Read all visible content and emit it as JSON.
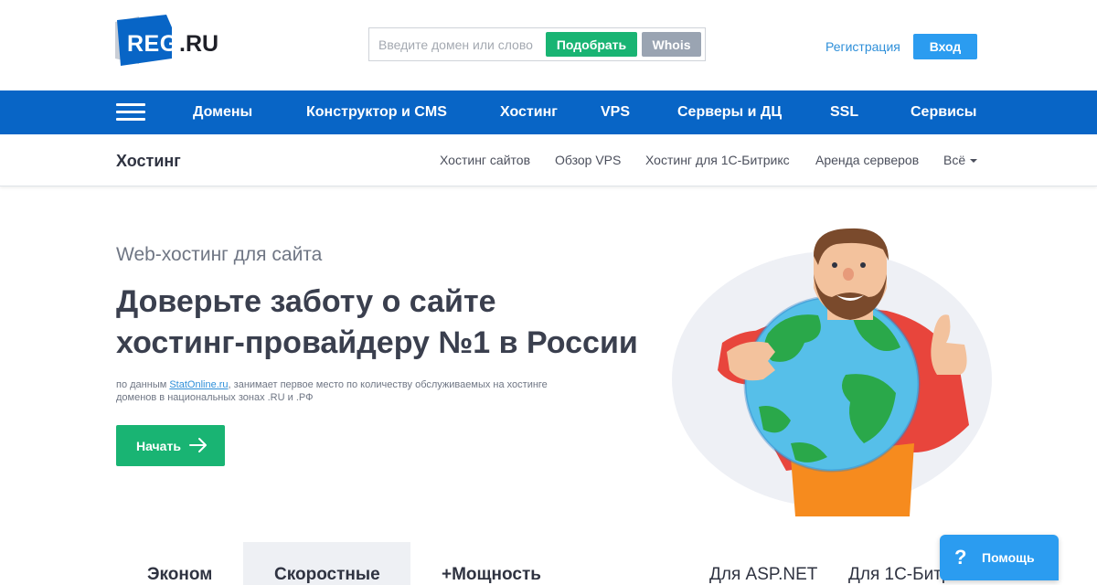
{
  "header": {
    "logo": {
      "brand": "REG",
      "suffix": ".RU"
    },
    "search": {
      "placeholder": "Введите домен или слово",
      "pick_label": "Подобрать",
      "whois_label": "Whois"
    },
    "register_label": "Регистрация",
    "login_label": "Вход"
  },
  "nav": {
    "items": [
      "Домены",
      "Конструктор и CMS",
      "Хостинг",
      "VPS",
      "Серверы и ДЦ",
      "SSL",
      "Сервисы"
    ]
  },
  "subnav": {
    "title": "Хостинг",
    "items": [
      "Хостинг сайтов",
      "Обзор VPS",
      "Хостинг для 1С-Битрикс",
      "Аренда серверов",
      "Всё"
    ]
  },
  "hero": {
    "subtitle": "Web-хостинг для сайта",
    "title_line1": "Доверьте заботу о сайте",
    "title_line2": "хостинг-провайдеру №1 в России",
    "note_prefix": "по данным ",
    "note_link": "StatOnline.ru",
    "note_suffix": ", занимает первое место по количеству обслуживаемых на хостинге",
    "note_line2": "доменов в национальных зонах .RU и .РФ",
    "start_label": "Начать"
  },
  "tabs": {
    "items": [
      "Эконом",
      "Скоростные",
      "+Мощность",
      "Для ASP.NET",
      "Для 1С-Битр"
    ],
    "active": "Скоростные"
  },
  "help": {
    "label": "Помощь",
    "icon": "?"
  },
  "colors": {
    "nav_blue": "#0865c6",
    "accent_green": "#19b473",
    "link_blue": "#2e8fd9",
    "button_blue": "#2b9cf0",
    "whois_gray": "#9aa4b2"
  }
}
